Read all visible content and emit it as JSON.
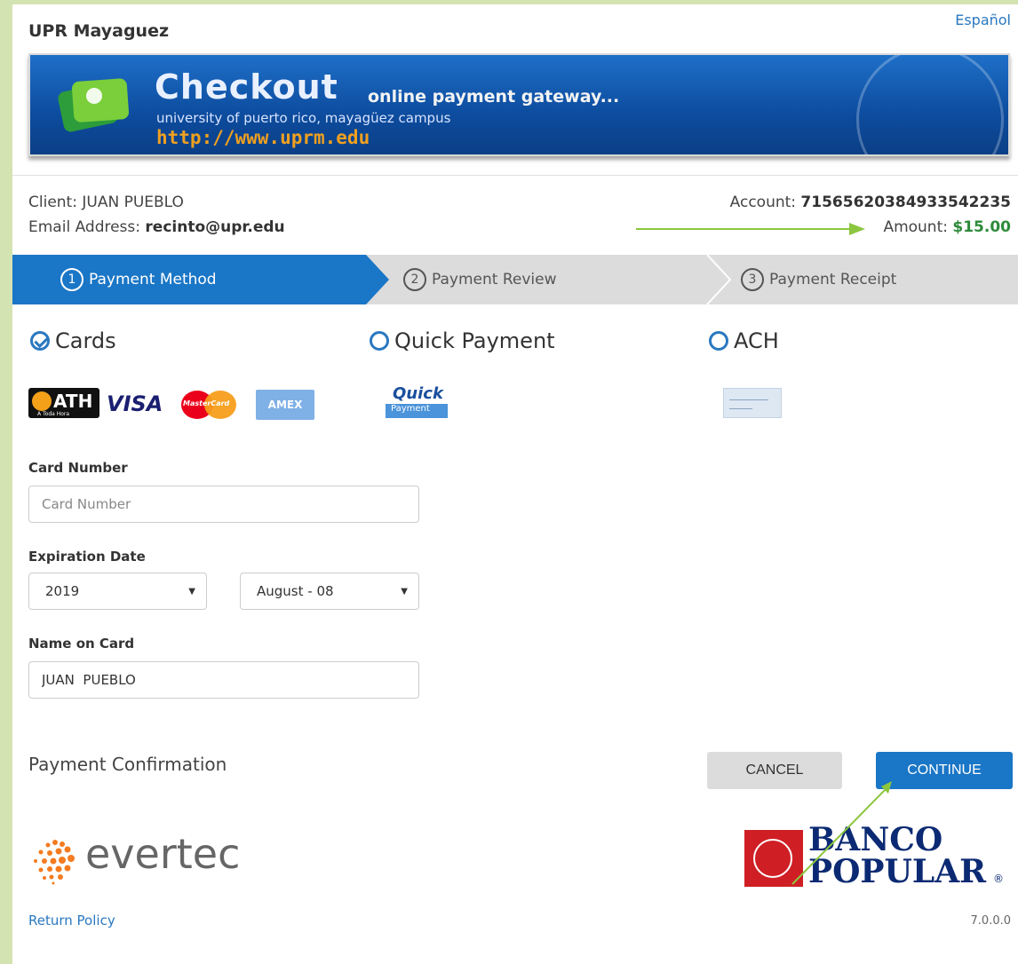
{
  "header": {
    "site_name": "UPR Mayaguez",
    "language_link": "Español"
  },
  "banner": {
    "title": "Checkout",
    "subtitle": "online payment gateway...",
    "university": "university of puerto rico, mayagüez campus",
    "url": "http://www.uprm.edu"
  },
  "client": {
    "client_label": "Client:",
    "client_name": "JUAN PUEBLO",
    "email_label": "Email Address:",
    "email": "recinto@upr.edu",
    "account_label": "Account:",
    "account": "71565620384933542235",
    "amount_label": "Amount:",
    "amount": "$15.00"
  },
  "steps": [
    {
      "num": "1",
      "label": "Payment Method",
      "active": true
    },
    {
      "num": "2",
      "label": "Payment Review",
      "active": false
    },
    {
      "num": "3",
      "label": "Payment Receipt",
      "active": false
    }
  ],
  "methods": [
    {
      "label": "Cards",
      "selected": true
    },
    {
      "label": "Quick Payment",
      "selected": false
    },
    {
      "label": "ACH",
      "selected": false
    }
  ],
  "card_logos": {
    "ath": "ATH",
    "ath_sub": "A Toda Hora",
    "visa": "VISA",
    "mastercard": "MasterCard",
    "amex": "AMEX",
    "quick": "Quick",
    "quick_sub": "Payment"
  },
  "form": {
    "card_number_label": "Card Number",
    "card_number_placeholder": "Card Number",
    "card_number_value": "",
    "expiration_label": "Expiration Date",
    "year": "2019",
    "month": "August - 08",
    "name_label": "Name on Card",
    "name_value": "JUAN  PUEBLO"
  },
  "confirmation": {
    "title": "Payment Confirmation",
    "cancel": "CANCEL",
    "continue": "CONTINUE"
  },
  "footer": {
    "evertec": "evertec",
    "banco_line1": "BANCO",
    "banco_line2": "POPULAR",
    "return_policy": "Return Policy",
    "version": "7.0.0.0"
  },
  "colors": {
    "primary": "#1a76c6",
    "amount": "#2e8b3a",
    "annotation_arrow": "#8cc63f",
    "sidebar": "#d4e3b2"
  }
}
